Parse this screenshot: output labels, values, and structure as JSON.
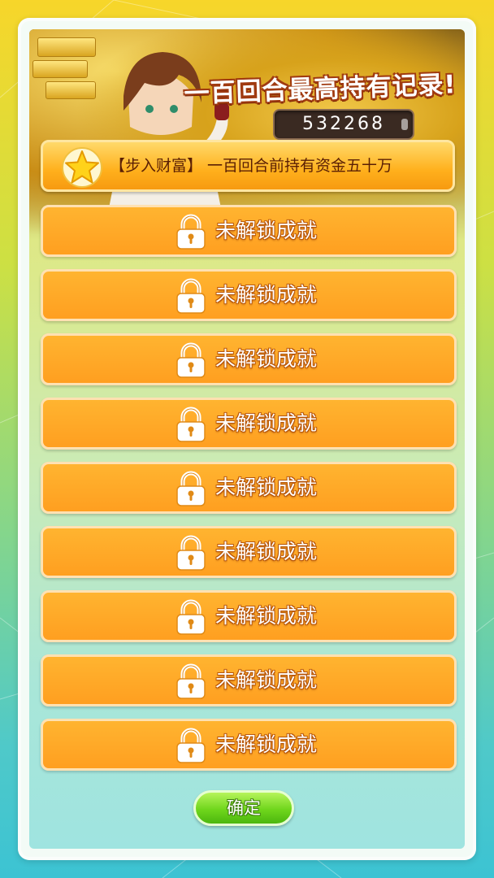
{
  "header": {
    "title": "一百回合最高持有记录!",
    "record_value": "532268"
  },
  "achievements": {
    "unlocked": {
      "label": "【步入财富】 一百回合前持有资金五十万",
      "icon": "star-icon"
    },
    "locked_items": [
      {
        "label": "未解锁成就"
      },
      {
        "label": "未解锁成就"
      },
      {
        "label": "未解锁成就"
      },
      {
        "label": "未解锁成就"
      },
      {
        "label": "未解锁成就"
      },
      {
        "label": "未解锁成就"
      },
      {
        "label": "未解锁成就"
      },
      {
        "label": "未解锁成就"
      },
      {
        "label": "未解锁成就"
      }
    ],
    "locked_icon": "lock-icon"
  },
  "footer": {
    "confirm_label": "确定"
  },
  "colors": {
    "achievement_orange": "#ff9f20",
    "confirm_green": "#6fd61c",
    "title_outline": "#a03a10"
  }
}
